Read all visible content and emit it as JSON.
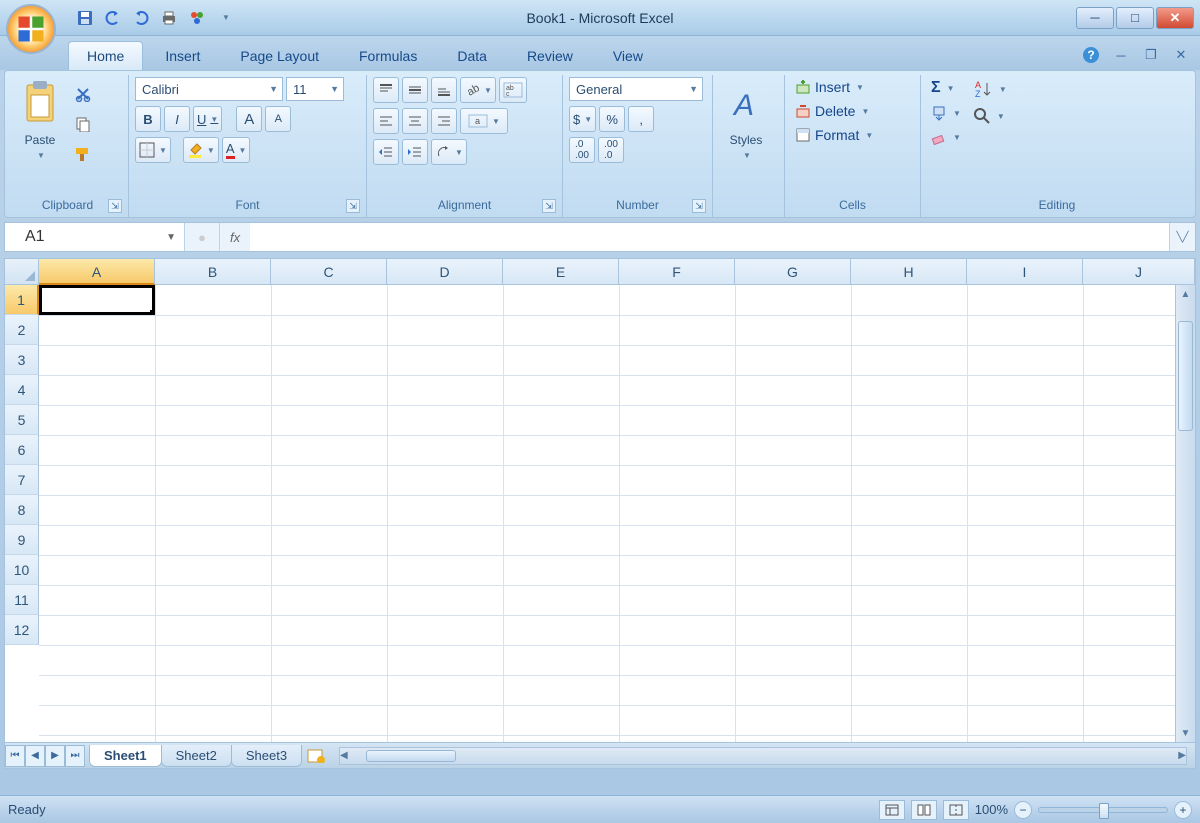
{
  "titlebar": {
    "title": "Book1 - Microsoft Excel"
  },
  "tabs": {
    "items": [
      "Home",
      "Insert",
      "Page Layout",
      "Formulas",
      "Data",
      "Review",
      "View"
    ],
    "active": 0
  },
  "ribbon": {
    "clipboard": {
      "label": "Clipboard",
      "paste": "Paste"
    },
    "font": {
      "label": "Font",
      "name": "Calibri",
      "size": "11",
      "bold": "B",
      "italic": "I",
      "underline": "U"
    },
    "alignment": {
      "label": "Alignment"
    },
    "number": {
      "label": "Number",
      "format": "General",
      "currency": "$",
      "percent": "%",
      "comma": ","
    },
    "styles": {
      "label": "Styles"
    },
    "cells": {
      "label": "Cells",
      "insert": "Insert",
      "delete": "Delete",
      "format": "Format"
    },
    "editing": {
      "label": "Editing",
      "sigma": "Σ"
    }
  },
  "formula": {
    "namebox": "A1",
    "fx": "fx"
  },
  "grid": {
    "columns": [
      "A",
      "B",
      "C",
      "D",
      "E",
      "F",
      "G",
      "H",
      "I",
      "J"
    ],
    "rows": [
      "1",
      "2",
      "3",
      "4",
      "5",
      "6",
      "7",
      "8",
      "9",
      "10",
      "11",
      "12"
    ],
    "active_cell": "A1"
  },
  "sheets": {
    "tabs": [
      "Sheet1",
      "Sheet2",
      "Sheet3"
    ],
    "active": 0
  },
  "status": {
    "text": "Ready",
    "zoom": "100%"
  }
}
